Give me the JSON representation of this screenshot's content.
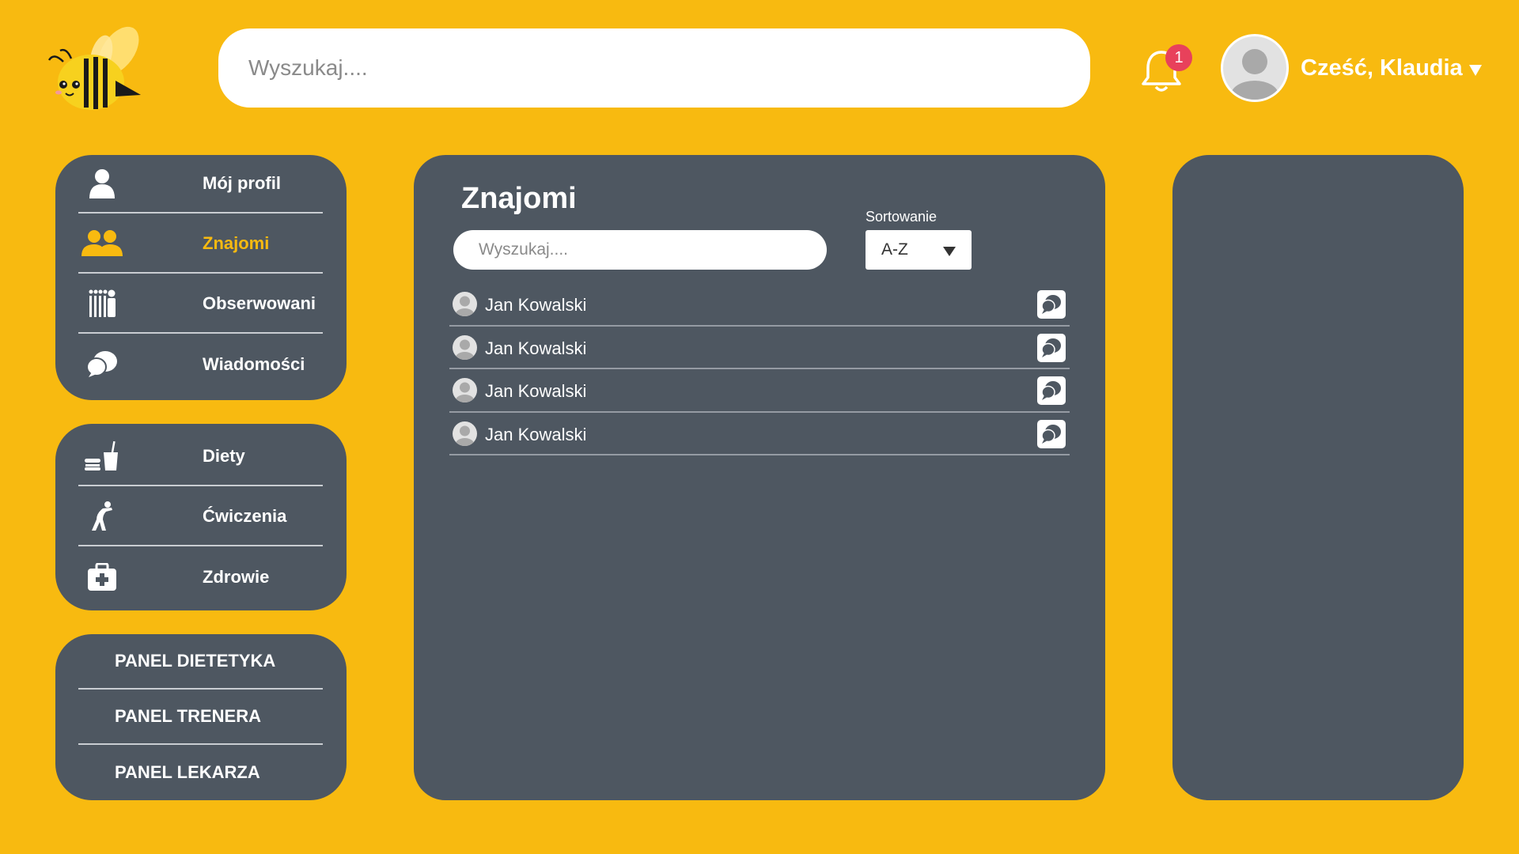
{
  "header": {
    "search_placeholder": "Wyszukaj....",
    "notifications_count": "1",
    "greeting": "Cześć, Klaudia"
  },
  "sidebar": {
    "nav": [
      {
        "label": "Mój profil",
        "icon": "user-icon",
        "active": false
      },
      {
        "label": "Znajomi",
        "icon": "friends-icon",
        "active": true
      },
      {
        "label": "Obserwowani",
        "icon": "followers-icon",
        "active": false
      },
      {
        "label": "Wiadomości",
        "icon": "chat-icon",
        "active": false
      }
    ],
    "health": [
      {
        "label": "Diety",
        "icon": "food-icon"
      },
      {
        "label": "Ćwiczenia",
        "icon": "exercise-icon"
      },
      {
        "label": "Zdrowie",
        "icon": "first-aid-icon"
      }
    ],
    "panels": [
      {
        "label": "PANEL DIETETYKA"
      },
      {
        "label": "PANEL TRENERA"
      },
      {
        "label": "PANEL LEKARZA"
      }
    ]
  },
  "main": {
    "title": "Znajomi",
    "search_placeholder": "Wyszukaj....",
    "sort_label": "Sortowanie",
    "sort_value": "A-Z",
    "friends": [
      {
        "name": "Jan Kowalski"
      },
      {
        "name": "Jan Kowalski"
      },
      {
        "name": "Jan Kowalski"
      },
      {
        "name": "Jan Kowalski"
      }
    ]
  },
  "colors": {
    "background": "#F8BA10",
    "card": "#4E5761",
    "accent": "#F8BA10",
    "badge": "#E8415B"
  }
}
